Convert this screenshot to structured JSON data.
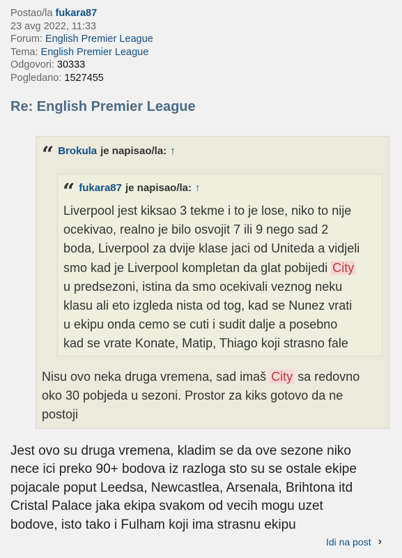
{
  "post": {
    "author_label": "Postao/la",
    "author": "fukara87",
    "date": "23 avg 2022, 11:33",
    "forum_label": "Forum:",
    "forum": "English Premier League",
    "topic_label": "Tema:",
    "topic": "English Premier League",
    "replies_label": "Odgovori:",
    "replies": "30333",
    "views_label": "Pogledano:",
    "views": "1527455",
    "title": "Re: English Premier League"
  },
  "outer_quote": {
    "author": "Brokula",
    "suffix": "je napisao/la:",
    "arrow": "↑",
    "lines": [
      "Nisu ovo neka druga vremena, sad imaš",
      "City",
      "sa redovno",
      "oko 30 pobjeda u sezoni. Prostor za kiks gotovo da ne",
      "postoji"
    ]
  },
  "inner_quote": {
    "author": "fukara87",
    "suffix": "je napisao/la:",
    "arrow": "↑",
    "lines": [
      "Liverpool jest kiksao 3 tekme i to je lose, niko to nije",
      "ocekivao, realno je bilo osvojit 7 ili 9 nego sad 2",
      "boda, Liverpool za dvije klase jaci od Uniteda a vidjeli",
      "smo kad je Liverpool kompletan da glat pobijedi",
      "City",
      "u predsezoni, istina da smo ocekivali veznog neku",
      "klasu ali eto izgleda nista od tog, kad se Nunez vrati",
      "u ekipu onda cemo se cuti i sudit dalje a posebno",
      "kad se vrate Konate, Matip, Thiago koji strasno fale"
    ]
  },
  "body_lines": [
    "Jest ovo su druga vremena, kladim se da ove sezone niko",
    "nece ici preko 90+ bodova iz razloga sto su se ostale ekipe",
    "pojacale poput Leedsa, Newcastlea, Arsenala, Brihtona itd",
    "Cristal Palace jaka ekipa svakom od vecih mogu uzet",
    "bodove, isto tako i Fulham koji ima strasnu ekipu"
  ],
  "goto_label": "Idi na post",
  "colors": {
    "link": "#105289",
    "title": "#4a6b87",
    "quote_bg": "#ebeadd",
    "highlight_bg": "#f9d6d6",
    "highlight_fg": "#b83c3c"
  }
}
